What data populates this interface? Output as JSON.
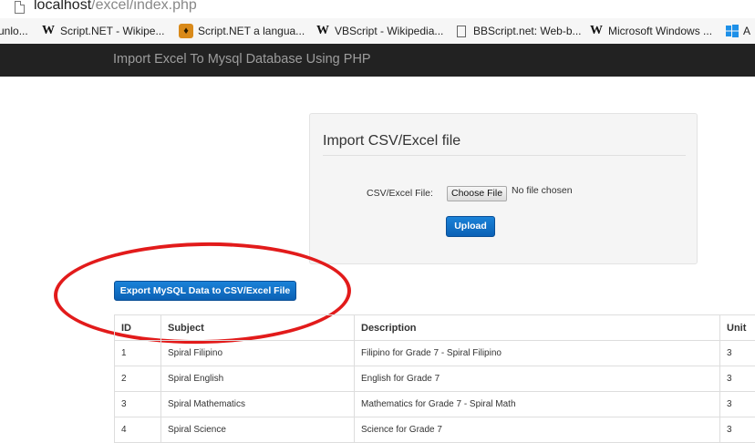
{
  "browser": {
    "url_host": "localhost",
    "url_path": "/excel/index.php",
    "bookmarks": [
      {
        "label": "unlo...",
        "icon": "none"
      },
      {
        "label": "Script.NET - Wikipe...",
        "icon": "wikipedia-icon"
      },
      {
        "label": "Script.NET a langua...",
        "icon": "gecko-icon"
      },
      {
        "label": "VBScript - Wikipedia...",
        "icon": "wikipedia-icon"
      },
      {
        "label": "BBScript.net: Web-b...",
        "icon": "page-icon"
      },
      {
        "label": "Microsoft Windows ...",
        "icon": "wikipedia-icon"
      },
      {
        "label": "A",
        "icon": "windows-icon"
      }
    ]
  },
  "navbar": {
    "brand": "Import Excel To Mysql Database Using PHP"
  },
  "import_form": {
    "legend": "Import CSV/Excel file",
    "file_label": "CSV/Excel File:",
    "choose_button": "Choose File",
    "no_file_text": "No file chosen",
    "upload_button": "Upload"
  },
  "export_button": "Export MySQL Data to CSV/Excel File",
  "annotation_color": "#e21b1b",
  "table": {
    "headers": [
      "ID",
      "Subject",
      "Description",
      "Unit"
    ],
    "rows": [
      [
        "1",
        "Spiral Filipino",
        "Filipino for Grade 7 - Spiral Filipino",
        "3"
      ],
      [
        "2",
        "Spiral English",
        "English for Grade 7",
        "3"
      ],
      [
        "3",
        "Spiral Mathematics",
        "Mathematics for Grade 7 - Spiral Math",
        "3"
      ],
      [
        "4",
        "Spiral Science",
        "Science for Grade 7",
        "3"
      ]
    ]
  }
}
